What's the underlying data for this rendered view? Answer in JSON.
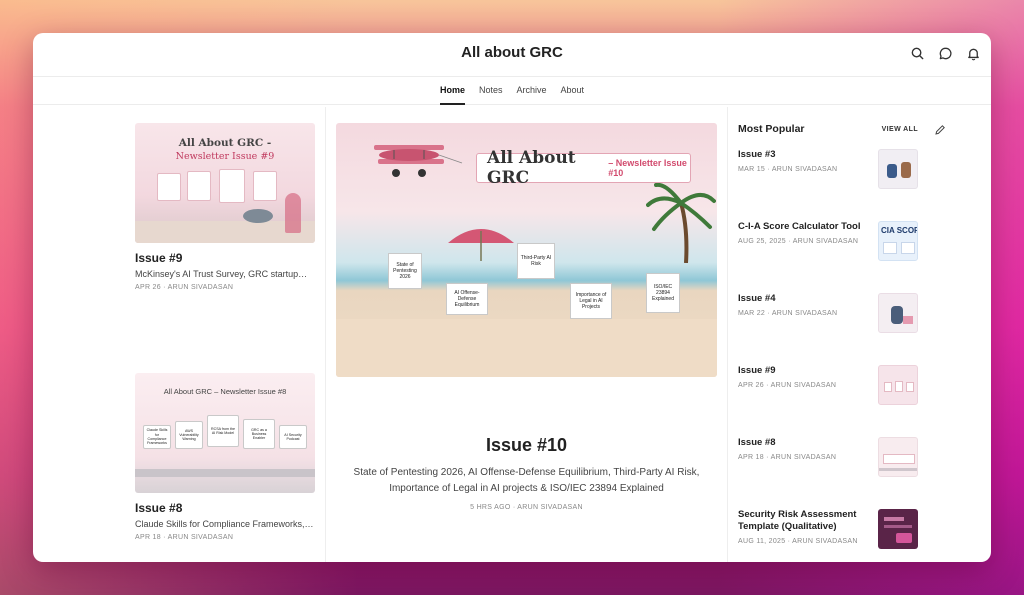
{
  "header": {
    "site_title": "All about GRC",
    "icons": [
      "search-icon",
      "chat-icon",
      "bell-icon"
    ]
  },
  "nav": {
    "tabs": [
      {
        "label": "Home",
        "active": true
      },
      {
        "label": "Notes",
        "active": false
      },
      {
        "label": "Archive",
        "active": false
      },
      {
        "label": "About",
        "active": false
      }
    ]
  },
  "left": {
    "posts": [
      {
        "thumb_title": "All About GRC -",
        "thumb_subtitle": "Newsletter Issue #9",
        "title": "Issue #9",
        "subtitle": "McKinsey's AI Trust Survey, GRC startup…",
        "meta": "APR 26 · ARUN SIVADASAN"
      },
      {
        "thumb_title": "All About GRC – Newsletter Issue #8",
        "thumb_boards": [
          "Claude Skills for Compliance Frameworks",
          "AWS Vulnerability Warning",
          "RCSA from the AI Risk Model",
          "GRC as a Business Enabler",
          "AI Security Podcast"
        ],
        "title": "Issue #8",
        "subtitle": "Claude Skills for Compliance Frameworks,…",
        "meta": "APR 18 · ARUN SIVADASAN"
      }
    ]
  },
  "main": {
    "hero_banner": "All About GRC",
    "hero_banner_small": "– Newsletter Issue #10",
    "hero_signs": [
      "State of Pentesting 2026",
      "AI Offense-Defense Equilibrium",
      "Third-Party AI Risk",
      "Importance of Legal in AI Projects",
      "ISO/IEC 23894 Explained"
    ],
    "title": "Issue #10",
    "subtitle": "State of Pentesting 2026, AI Offense-Defense Equilibrium, Third-Party AI Risk, Importance of Legal in AI projects & ISO/IEC 23894 Explained",
    "meta": "5 HRS AGO · ARUN SIVADASAN"
  },
  "popular": {
    "heading": "Most Popular",
    "view_all": "VIEW ALL",
    "items": [
      {
        "title": "Issue #3",
        "meta": "MAR 15 · ARUN SIVADASAN",
        "thumb_color": "#f1eef3"
      },
      {
        "title": "C-I-A Score Calculator Tool",
        "meta": "AUG 25, 2025 · ARUN SIVADASAN",
        "thumb_color": "#e8f1fb",
        "thumb_text": "CIA SCOR"
      },
      {
        "title": "Issue #4",
        "meta": "MAR 22 · ARUN SIVADASAN",
        "thumb_color": "#f4eef2"
      },
      {
        "title": "Issue #9",
        "meta": "APR 26 · ARUN SIVADASAN",
        "thumb_color": "#f6e4ea"
      },
      {
        "title": "Issue #8",
        "meta": "APR 18 · ARUN SIVADASAN",
        "thumb_color": "#f8ecef"
      },
      {
        "title": "Security Risk Assessment Template (Qualitative)",
        "meta": "AUG 11, 2025 · ARUN SIVADASAN",
        "thumb_color": "#5a2448"
      }
    ]
  }
}
